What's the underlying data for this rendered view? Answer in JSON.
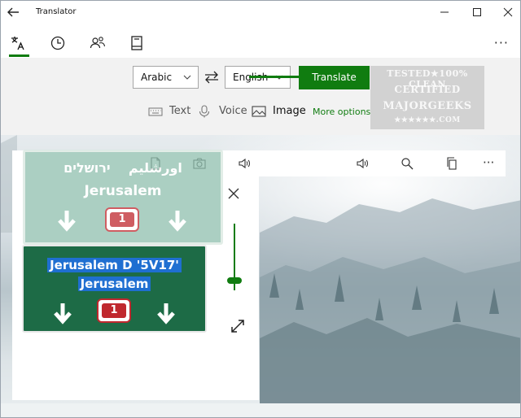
{
  "window": {
    "title": "Translator"
  },
  "nav": {
    "tabs": [
      "translator",
      "history",
      "conversation",
      "phrasebook"
    ]
  },
  "languages": {
    "from": "Arabic",
    "to": "English"
  },
  "actions": {
    "translate": "Translate",
    "more_options": "More options"
  },
  "modes": {
    "text": "Text",
    "voice": "Voice",
    "image": "Image"
  },
  "watermark": {
    "line1": "TESTED★100% CLEAN",
    "line2": "CERTIFIED",
    "line3": "MAJORGEEKS",
    "line4": "★★★★★★.COM"
  },
  "signs": {
    "upper": {
      "hebrew": "ירושלים",
      "arabic": "اورشليم",
      "english": "Jerusalem",
      "route": "1"
    },
    "lower": {
      "detected_line1": "Jerusalem D '5V17'",
      "detected_line2": "Jerusalem",
      "route": "1"
    }
  },
  "colors": {
    "accent": "#107c10",
    "selection": "#1f6fd1",
    "sign_green": "#1d6b46"
  }
}
